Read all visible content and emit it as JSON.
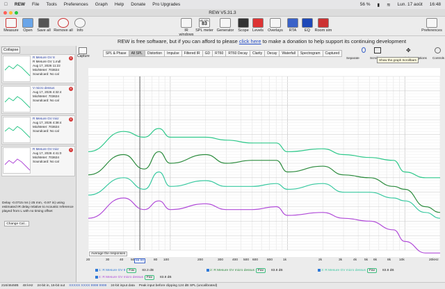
{
  "menubar": {
    "app": "REW",
    "items": [
      "File",
      "Tools",
      "Preferences",
      "Graph",
      "Help",
      "Donate",
      "Pro Upgrades"
    ],
    "battery": "56 %",
    "date": "Lun. 17 août",
    "time": "16:48"
  },
  "window": {
    "title": "REW V5.31.3"
  },
  "toolbar": {
    "left": [
      "Measure",
      "Open",
      "Save all",
      "Remove all",
      "Info"
    ],
    "right": [
      "IR windows",
      "SPL meter",
      "Generator",
      "Scope",
      "Levels",
      "Overlays",
      "RTA",
      "EQ",
      "Room sim"
    ],
    "spl_value": "83",
    "spl_unit": "dB SPL",
    "preferences": "Preferences"
  },
  "banner": {
    "prefix": "REW is free software, but if you can afford to please ",
    "link": "click here",
    "suffix": " to make a donation to help support its continuing development"
  },
  "sidebar": {
    "collapse": "Collapse",
    "measurements": [
      {
        "name": "R Mesure GV 8",
        "line1": "R Mesure GV 1.mdl",
        "line2": "Aug 17, 2026 11:22",
        "line3": "Mic/Meter: 703634",
        "line4": "Soundcard: No cal"
      },
      {
        "name": "V micro dessus",
        "line1": "Aug 17, 2026 4:32:4",
        "line2": "Mic/Meter: 703634",
        "line3": "Soundcard: No cal",
        "line4": ""
      },
      {
        "name": "R Mesure GV micr",
        "line1": "Aug 17, 2026 4:38:4",
        "line2": "Mic/Meter: 703634",
        "line3": "Soundcard: No cal",
        "line4": ""
      },
      {
        "name": "R Mesure GV micr",
        "line1": "Aug 17, 2026 4:41:0",
        "line2": "Mic/Meter: 703634",
        "line3": "Soundcard: No cal",
        "line4": ""
      }
    ],
    "delay_text": "Delay -0.0715 ms (-25 mm, -0.97 in) using estimated IR delay relative to Acoustic reference played from L with no timing offset",
    "change_cal": "Change Cal..."
  },
  "capture": "Capture",
  "tabs": [
    "SPL & Phase",
    "All SPL",
    "Distortion",
    "Impulse",
    "Filtered IR",
    "GD",
    "RT60",
    "RT60 Decay",
    "Clarity",
    "Decay",
    "Waterfall",
    "Spectrogram",
    "Captured"
  ],
  "active_tab": "All SPL",
  "graph_tools": [
    "Separate",
    "Scroll",
    "Limits",
    "Options",
    "Controls"
  ],
  "tooltip": "Show the graph Scrollbars",
  "average_button": "Average the responses",
  "chart_data": {
    "type": "line",
    "xscale": "log",
    "xlim": [
      20,
      20000
    ],
    "ylim": [
      45,
      105
    ],
    "x_ticks": [
      "20",
      "30",
      "40",
      "50",
      "60",
      "80",
      "100",
      "200",
      "300",
      "400",
      "500",
      "600",
      "800",
      "1k",
      "2k",
      "3k",
      "4k",
      "5k",
      "6k",
      "8k",
      "10k",
      "20kHz"
    ],
    "y_ticks": [
      "50",
      "55",
      "60",
      "65",
      "70",
      "75",
      "80",
      "85",
      "90",
      "95",
      "100"
    ],
    "cursor_x_label": "55.00",
    "series": [
      {
        "name": "1: R Mesure GV 8",
        "color": "#2ec88a",
        "x": [
          20,
          40,
          60,
          80,
          100,
          200,
          300,
          500,
          800,
          1000,
          2000,
          3000,
          5000,
          8000,
          10000,
          15000,
          20000
        ],
        "y": [
          79,
          86,
          84,
          87,
          84,
          84,
          83,
          82,
          82,
          79,
          80,
          78,
          77,
          76,
          72,
          70,
          70
        ]
      },
      {
        "name": "2: R Mesure GV micro dessus",
        "color": "#2a8a3c",
        "x": [
          20,
          40,
          60,
          80,
          100,
          200,
          300,
          500,
          800,
          1000,
          2000,
          3000,
          5000,
          8000,
          10000,
          15000,
          20000
        ],
        "y": [
          71,
          78,
          73,
          79,
          75,
          78,
          75,
          76,
          76,
          72,
          74,
          71,
          70,
          67,
          66,
          60,
          58
        ]
      },
      {
        "name": "3: R Mesure GV micro dessus",
        "color": "#39c9a0",
        "x": [
          20,
          40,
          60,
          80,
          100,
          200,
          300,
          500,
          800,
          1000,
          2000,
          3000,
          5000,
          8000,
          10000,
          15000,
          20000
        ],
        "y": [
          64,
          70,
          66,
          72,
          67,
          69,
          67,
          67,
          68,
          66,
          68,
          65,
          65,
          63,
          62,
          58,
          56
        ]
      },
      {
        "name": "4: R Mesure GV micro dessus",
        "color": "#b04ad8",
        "x": [
          20,
          40,
          60,
          80,
          100,
          200,
          300,
          500,
          800,
          1000,
          2000,
          3000,
          5000,
          8000,
          10000,
          15000,
          20000
        ],
        "y": [
          56,
          63,
          59,
          62,
          59,
          61,
          59,
          59,
          60,
          57,
          58,
          56,
          55,
          52,
          48,
          44,
          44
        ]
      }
    ]
  },
  "legend": [
    {
      "name": "1: R Mesure GV 8",
      "pill": "Fav",
      "value": "83.3 dB"
    },
    {
      "name": "2: R Mesure GV micro dessus",
      "pill": "Fav",
      "value": "83.8 dB"
    },
    {
      "name": "3: R Mesure GV micro dessus",
      "pill": "Fav",
      "value": "83.8 dB"
    },
    {
      "name": "4: R Mesure GV micro dessus",
      "pill": "Fav",
      "value": "83.8 dB"
    }
  ],
  "statusbar": {
    "mem": "216/464MB",
    "rate": "48 kHz",
    "bits": "24-bit in, 16-bit out",
    "levels": "XXXXX XXXX 9999 9999",
    "input": "24-bit input data",
    "peak": "Peak input before clipping 124 dB SPL (uncalibrated)"
  }
}
